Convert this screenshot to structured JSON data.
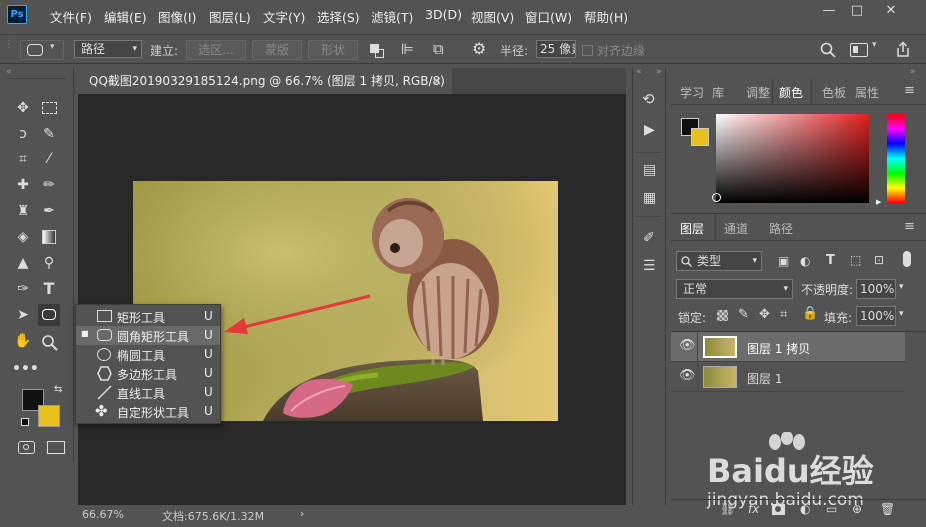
{
  "app": {
    "logo": "Ps"
  },
  "menu": [
    "文件(F)",
    "编辑(E)",
    "图像(I)",
    "图层(L)",
    "文字(Y)",
    "选择(S)",
    "滤镜(T)",
    "3D(D)",
    "视图(V)",
    "窗口(W)",
    "帮助(H)"
  ],
  "window_controls": {
    "minimize": "—",
    "maximize": "□",
    "close": "✕"
  },
  "options": {
    "mode_value": "路径",
    "build_label": "建立:",
    "selection_btn": "选区...",
    "mask_btn": "蒙版",
    "shape_btn": "形状",
    "radius_label": "半径:",
    "radius_value": "25 像素",
    "align_edges": "对齐边缘"
  },
  "document": {
    "tab_title": "QQ截图20190329185124.png @ 66.7% (图层 1 拷贝, RGB/8) *",
    "tab_close": "×",
    "zoom": "66.67%",
    "doc_size": "文档:675.6K/1.32M",
    "arrow": "›"
  },
  "flyout": [
    {
      "label": "矩形工具",
      "key": "U",
      "icon": "rectangle-icon",
      "active": false
    },
    {
      "label": "圆角矩形工具",
      "key": "U",
      "icon": "rounded-rectangle-icon",
      "active": true
    },
    {
      "label": "椭圆工具",
      "key": "U",
      "icon": "ellipse-icon",
      "active": false
    },
    {
      "label": "多边形工具",
      "key": "U",
      "icon": "polygon-icon",
      "active": false
    },
    {
      "label": "直线工具",
      "key": "U",
      "icon": "line-icon",
      "active": false
    },
    {
      "label": "自定形状工具",
      "key": "U",
      "icon": "custom-shape-icon",
      "active": false
    }
  ],
  "color_panel": {
    "tabs": [
      "学习",
      "库",
      "调整",
      "颜色",
      "色板",
      "属性"
    ],
    "active_tab": "颜色",
    "foreground": "#111111",
    "background": "#e8c11c"
  },
  "layers_panel": {
    "tabs": [
      "图层",
      "通道",
      "路径"
    ],
    "filter_label": "类型",
    "blend_mode": "正常",
    "opacity_label": "不透明度:",
    "opacity_value": "100%",
    "lock_label": "锁定:",
    "fill_label": "填充:",
    "fill_value": "100%",
    "layers": [
      {
        "name": "图层 1 拷贝",
        "selected": true
      },
      {
        "name": "图层 1",
        "selected": false
      }
    ],
    "footer_icons": [
      "link-icon",
      "fx-icon",
      "mask-icon",
      "adjustment-icon",
      "folder-icon",
      "new-layer-icon",
      "trash-icon"
    ]
  },
  "watermark": {
    "brand": "Baidu经验",
    "url": "jingyan.baidu.com"
  },
  "colors": {
    "accent_red": "#e23a3a",
    "panel": "#535353",
    "canvas": "#282828"
  }
}
